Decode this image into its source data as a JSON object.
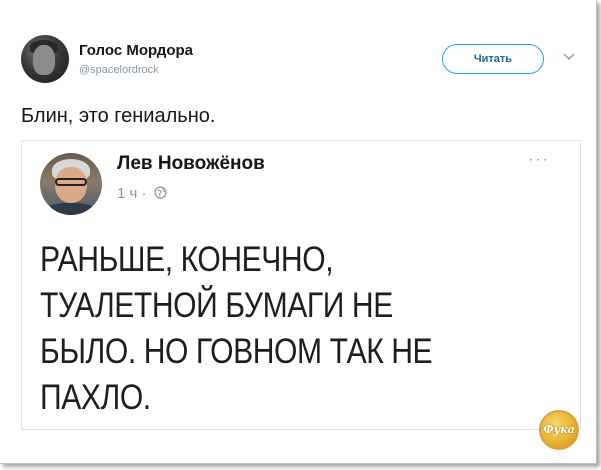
{
  "tweet": {
    "author_name": "Голос Мордора",
    "author_handle": "@spacelordrock",
    "follow_label": "Читать",
    "text": "Блин, это гениально."
  },
  "quote": {
    "author_name": "Лев Новожёнов",
    "time": "1 ч",
    "separator": "·",
    "more_label": "···",
    "body_lines": [
      "РАНЬШЕ, КОНЕЧНО,",
      "ТУАЛЕТНОЙ БУМАГИ НЕ",
      "БЫЛО. НО ГОВНОМ ТАК НЕ",
      "ПАХЛО."
    ]
  },
  "watermark": {
    "text": "Фука"
  },
  "colors": {
    "accent": "#1da1f2",
    "text_primary": "#14171a",
    "text_secondary": "#8899a6"
  },
  "icons": {
    "more": "chevron-down-icon",
    "visibility": "globe-icon"
  }
}
